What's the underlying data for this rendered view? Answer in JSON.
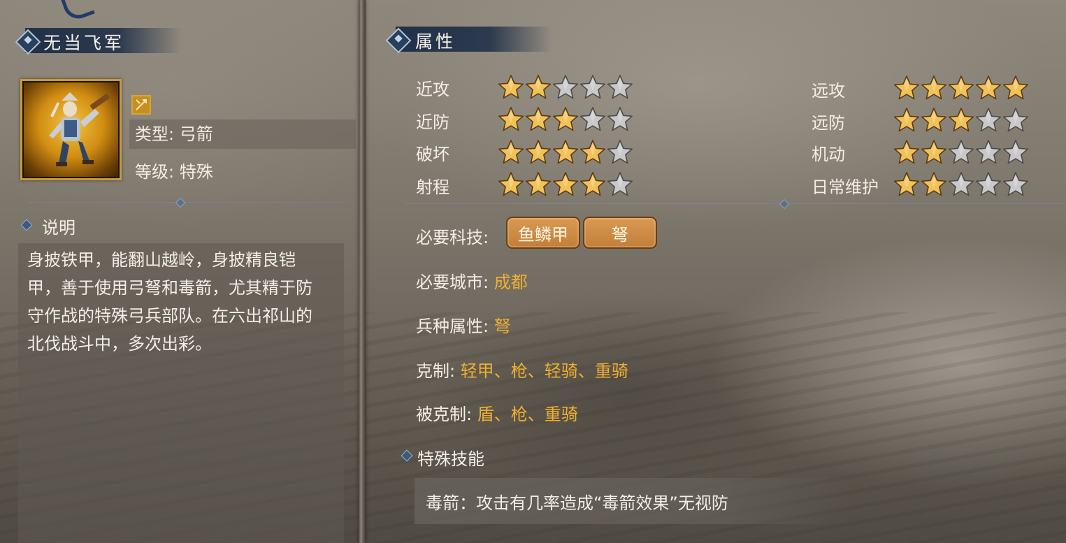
{
  "unit": {
    "name": "无当飞军",
    "type_label": "类型: 弓箭",
    "level_label": "等级: 特殊",
    "badge_icon": "crossed-arrows-icon"
  },
  "description": {
    "title": "说明",
    "text": "身披铁甲，能翻山越岭，身披精良铠甲，善于使用弓弩和毒箭，尤其精于防守作战的特殊弓兵部队。在六出祁山的北伐战斗中，多次出彩。"
  },
  "attributes": {
    "title": "属性",
    "left": [
      {
        "label": "近攻",
        "stars": 2
      },
      {
        "label": "近防",
        "stars": 3
      },
      {
        "label": "破坏",
        "stars": 4
      },
      {
        "label": "射程",
        "stars": 4
      }
    ],
    "right": [
      {
        "label": "远攻",
        "stars": 5
      },
      {
        "label": "远防",
        "stars": 3
      },
      {
        "label": "机动",
        "stars": 2
      },
      {
        "label": "日常维护",
        "stars": 2
      }
    ],
    "max_stars": 5
  },
  "properties": {
    "required_tech_label": "必要科技:",
    "required_tech": [
      "鱼鳞甲",
      "弩"
    ],
    "required_city_label": "必要城市:",
    "required_city": "成都",
    "troop_attr_label": "兵种属性:",
    "troop_attr": "弩",
    "counters_label": "克制:",
    "counters": "轻甲、枪、轻骑、重骑",
    "countered_by_label": "被克制:",
    "countered_by": "盾、枪、重骑"
  },
  "special_skill": {
    "title": "特殊技能",
    "text": "毒箭：攻击有几率造成“毒箭效果”无视防"
  },
  "colors": {
    "header_blue": "#1b2c46",
    "value_gold": "#f0b030",
    "star_gold": "#f2c25a",
    "star_grey": "#c9c9c9",
    "tech_tag": "#c9853f"
  }
}
